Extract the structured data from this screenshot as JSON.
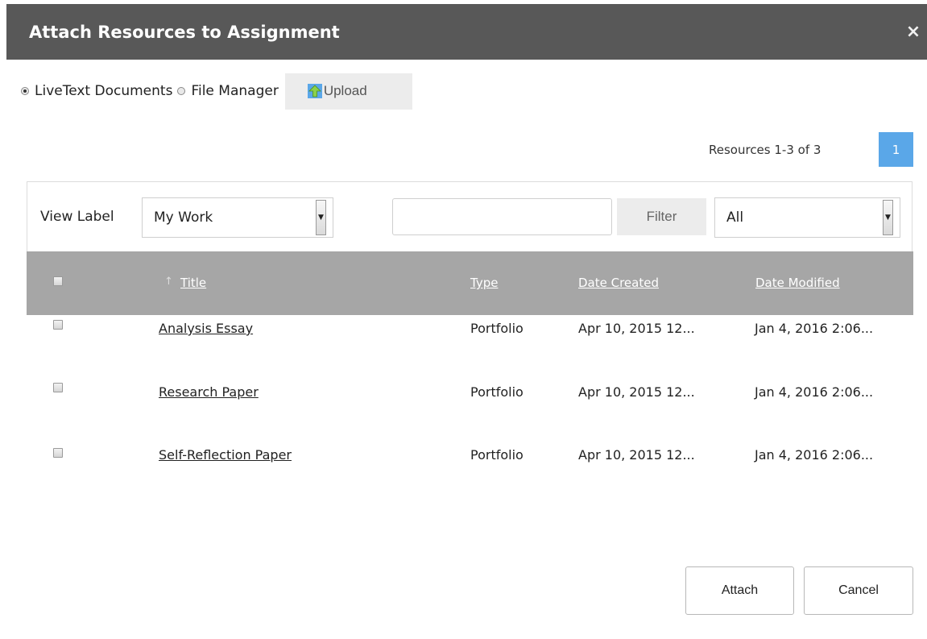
{
  "dialog": {
    "title": "Attach Resources to Assignment",
    "close_icon": "×"
  },
  "source": {
    "options": [
      {
        "label": "LiveText Documents",
        "selected": true
      },
      {
        "label": "File Manager",
        "selected": false
      }
    ],
    "upload_label": "Upload",
    "upload_icon": "upload-arrow-icon"
  },
  "pagination": {
    "summary": "Resources 1-3 of 3",
    "pages": [
      "1"
    ],
    "current_page": "1"
  },
  "filters": {
    "view_label": "View Label",
    "view_select_value": "My Work",
    "search_value": "",
    "filter_button": "Filter",
    "type_select_value": "All"
  },
  "table": {
    "columns": [
      "Title",
      "Type",
      "Date Created",
      "Date Modified"
    ],
    "sort_icon": "↑",
    "rows": [
      {
        "title": "Analysis Essay",
        "type": "Portfolio",
        "created": "Apr 10, 2015 12...",
        "modified": "Jan 4, 2016 2:06..."
      },
      {
        "title": "Research Paper",
        "type": "Portfolio",
        "created": "Apr 10, 2015 12...",
        "modified": "Jan 4, 2016 2:06..."
      },
      {
        "title": "Self-Reflection Paper",
        "type": "Portfolio",
        "created": "Apr 10, 2015 12...",
        "modified": "Jan 4, 2016 2:06..."
      }
    ]
  },
  "actions": {
    "attach": "Attach",
    "cancel": "Cancel"
  },
  "colors": {
    "titlebar": "#585858",
    "page_button": "#5aa7e8",
    "table_header": "#a6a6a6",
    "upload_icon": "#5aa7e8"
  }
}
